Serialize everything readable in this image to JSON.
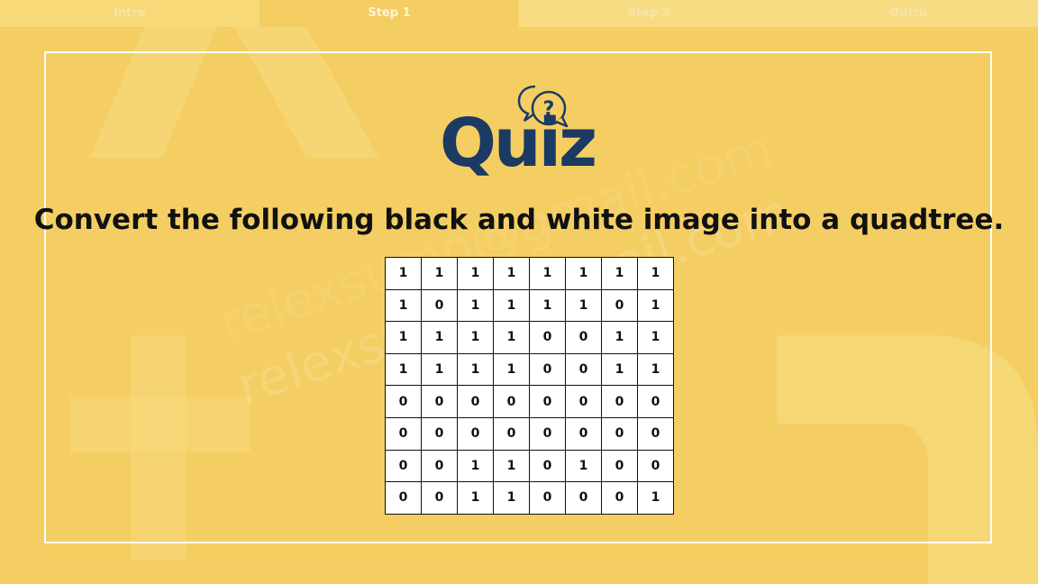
{
  "tabs": [
    {
      "label": "Intro",
      "active": false
    },
    {
      "label": "Step 1",
      "active": true
    },
    {
      "label": "Step 2",
      "active": false
    },
    {
      "label": "Outro",
      "active": false
    }
  ],
  "logo": {
    "word": "Quiz",
    "icon": "speech-bubbles-question-icon",
    "mark": "?"
  },
  "question": "Convert the following black and white image into a quadtree.",
  "grid": [
    [
      1,
      1,
      1,
      1,
      1,
      1,
      1,
      1
    ],
    [
      1,
      0,
      1,
      1,
      1,
      1,
      0,
      1
    ],
    [
      1,
      1,
      1,
      1,
      0,
      0,
      1,
      1
    ],
    [
      1,
      1,
      1,
      1,
      0,
      0,
      1,
      1
    ],
    [
      0,
      0,
      0,
      0,
      0,
      0,
      0,
      0
    ],
    [
      0,
      0,
      0,
      0,
      0,
      0,
      0,
      0
    ],
    [
      0,
      0,
      1,
      1,
      0,
      1,
      0,
      0
    ],
    [
      0,
      0,
      1,
      1,
      0,
      0,
      0,
      1
    ]
  ],
  "colors": {
    "background": "#f4ce62",
    "logo": "#1b3a64",
    "frame": "#ffffff"
  }
}
